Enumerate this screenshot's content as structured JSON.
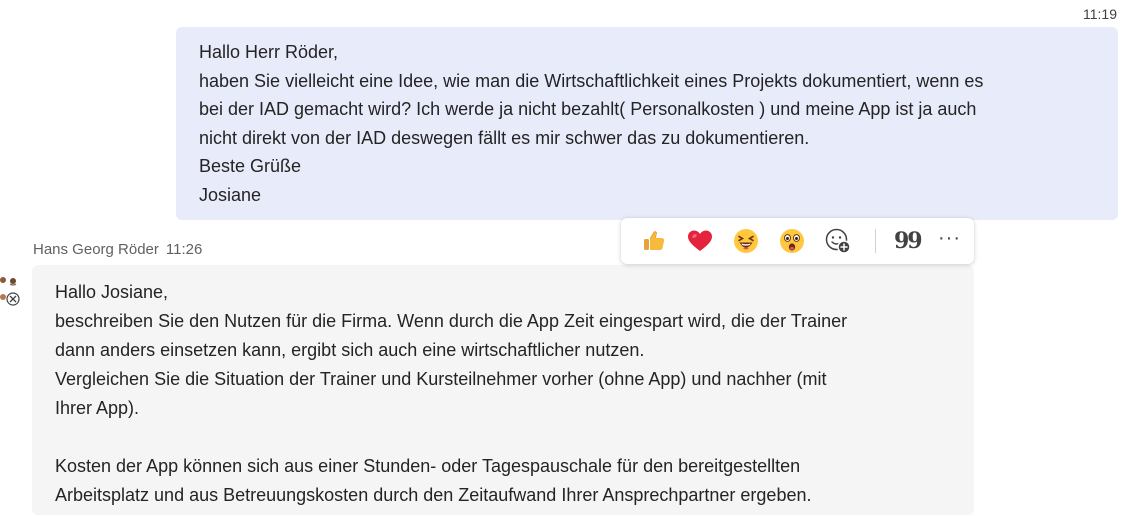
{
  "own_message": {
    "time": "11:19",
    "lines": [
      "Hallo Herr Röder,",
      "haben Sie vielleicht eine Idee, wie man die Wirtschaftlichkeit eines Projekts dokumentiert, wenn es",
      "bei der IAD gemacht wird? Ich werde ja nicht bezahlt( Personalkosten ) und meine App ist ja auch",
      "nicht direkt von der IAD deswegen fällt es mir schwer das zu dokumentieren.",
      "Beste Grüße",
      "Josiane"
    ]
  },
  "other_message": {
    "sender": "Hans Georg Röder",
    "time": "11:26",
    "lines": [
      "Hallo Josiane,",
      "beschreiben Sie den Nutzen für die Firma. Wenn durch die App Zeit eingespart wird, die der Trainer",
      "dann anders einsetzen kann, ergibt sich auch eine wirtschaftlicher nutzen.",
      "Vergleichen Sie die Situation der Trainer und Kursteilnehmer vorher (ohne App) und nachher (mit",
      "Ihrer App).",
      "",
      "Kosten der App können sich aus einer Stunden- oder Tagespauschale für den bereitgestellten",
      "Arbeitsplatz und aus Betreuungskosten durch den Zeitaufwand Ihrer Ansprechpartner ergeben."
    ]
  },
  "reaction_bar": {
    "reactions": [
      "thumbs-up-icon",
      "heart-icon",
      "laughing-icon",
      "surprised-icon",
      "add-reaction-icon"
    ],
    "quote_label": "99",
    "more_label": "···"
  },
  "colors": {
    "own_bubble": "#e8ebfa",
    "other_bubble": "#f5f5f5",
    "heart": "#e3243c",
    "emoji": "#ffc83d"
  }
}
